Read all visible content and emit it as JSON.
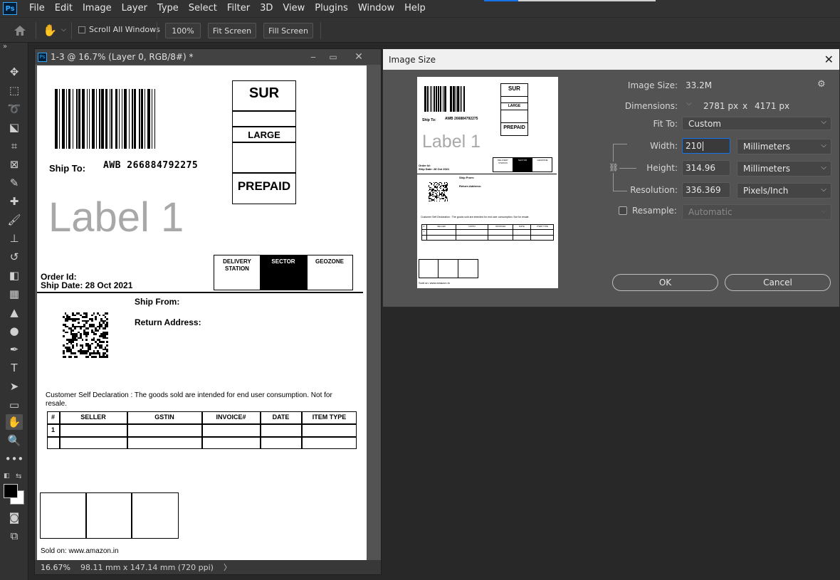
{
  "menubar": {
    "logo": "Ps",
    "items": [
      "File",
      "Edit",
      "Image",
      "Layer",
      "Type",
      "Select",
      "Filter",
      "3D",
      "View",
      "Plugins",
      "Window",
      "Help"
    ]
  },
  "options": {
    "scroll_all_windows": "Scroll All Windows",
    "zoom_100": "100%",
    "fit_screen": "Fit Screen",
    "fill_screen": "Fill Screen"
  },
  "document": {
    "title": "1-3 @ 16.7% (Layer 0, RGB/8#) *",
    "status_zoom": "16.67%",
    "status_info": "98.11 mm x 147.14 mm (720 ppi)",
    "status_arrow": "〉"
  },
  "label": {
    "awb": "AWB 266884792275",
    "ship_to": "Ship To:",
    "sur": "SUR",
    "large": "LARGE",
    "prepaid": "PREPAID",
    "label_title": "Label 1",
    "order_id": "Order Id:",
    "ship_date": "Ship Date: 28 Oct 2021",
    "delivery_station": "DELIVERY STATION",
    "sector": "SECTOR",
    "geozone": "GEOZONE",
    "ship_from": "Ship From:",
    "return_address": "Return Address:",
    "declaration": "Customer Self Declaration : The goods sold are intended for end user consumption. Not for resale.",
    "table_headers": [
      "#",
      "SELLER",
      "GSTIN",
      "INVOICE#",
      "DATE",
      "ITEM TYPE"
    ],
    "table_row_1": [
      "1",
      "",
      "",
      "",
      "",
      ""
    ],
    "sold_on": "Sold on: www.amazon.in"
  },
  "preview": {
    "awb": "AWB 266884792275",
    "ship_to": "Ship To:",
    "sur": "SUR",
    "large": "LARGE",
    "prepaid": "PREPAID",
    "label_title": "Label 1",
    "order_id": "Order Id:",
    "ship_date": "Ship Date: 28 Oct 2021",
    "ship_from": "Ship From:",
    "return_address": "Return Address:",
    "delivery_station": "DELIVERY STATION",
    "sector": "SECTOR",
    "geozone": "GEOZONE",
    "declaration": "Customer Self Declaration : The goods sold are intended for end user consumption. Not for resale.",
    "table_headers": [
      "#",
      "SELLER",
      "GSTIN",
      "INVOICE#",
      "DATE",
      "ITEM TYPE"
    ],
    "table_row_1": [
      "1",
      "",
      "",
      "",
      "",
      ""
    ],
    "sold_on": "Sold on: www.amazon.in"
  },
  "dialog": {
    "title": "Image Size",
    "image_size_label": "Image Size:",
    "image_size_value": "33.2M",
    "dimensions_label": "Dimensions:",
    "dim_width": "2781 px",
    "dim_x": "x",
    "dim_height": "4171 px",
    "fit_to_label": "Fit To:",
    "fit_to_value": "Custom",
    "width_label": "Width:",
    "width_value": "210",
    "width_unit": "Millimeters",
    "height_label": "Height:",
    "height_value": "314.96",
    "height_unit": "Millimeters",
    "resolution_label": "Resolution:",
    "resolution_value": "336.369",
    "resolution_unit": "Pixels/Inch",
    "resample_label": "Resample:",
    "resample_value": "Automatic",
    "ok": "OK",
    "cancel": "Cancel"
  },
  "colors": {
    "accent": "#1473e6",
    "ps_blue": "#31a8ff",
    "panel": "#535353",
    "chrome": "#323232"
  }
}
